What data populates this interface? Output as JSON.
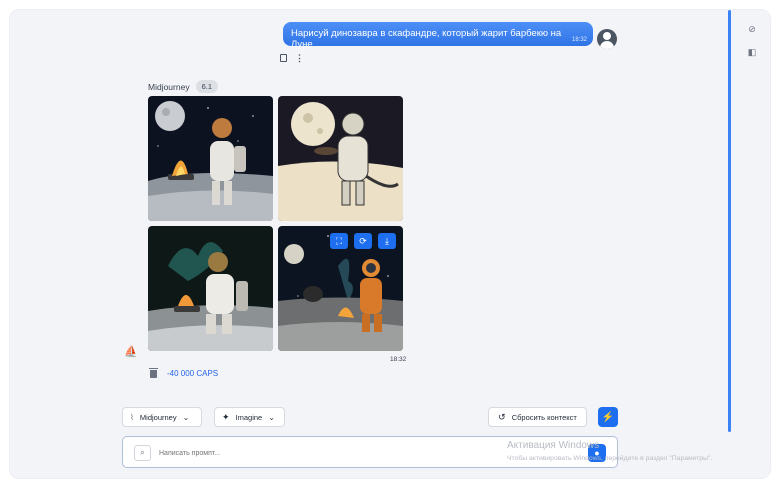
{
  "user_message": {
    "text": "Нарисуй динозавра в скафандре, который жарит барбекю на Луне",
    "time": "18:32"
  },
  "response": {
    "model_name": "Midjourney",
    "model_version": "6.1",
    "time": "18:32",
    "cost": "-40 000 CAPS"
  },
  "icons": {
    "copy": "copy-icon",
    "more": "more-vertical-icon",
    "expand": "expand-icon",
    "regenerate": "refresh-icon",
    "download": "download-icon",
    "delete": "trash-icon",
    "attach": "paperclip-icon",
    "mic": "microphone-icon",
    "lightning": "lightning-icon",
    "sidebar_hide": "eye-off-icon",
    "sidebar_panel": "panel-icon"
  },
  "controls": {
    "model_select": "Midjourney",
    "mode_select": "Imagine",
    "reset_label": "Сбросить контекст"
  },
  "prompt": {
    "placeholder": "Написать промпт..."
  },
  "watermark": {
    "title": "Активация Windows",
    "subtitle": "Чтобы активировать Windows, перейдите в раздел \"Параметры\"."
  },
  "colors": {
    "accent": "#1d6ff0",
    "bubble": "#3b82f6",
    "background": "#f3f4f7"
  }
}
